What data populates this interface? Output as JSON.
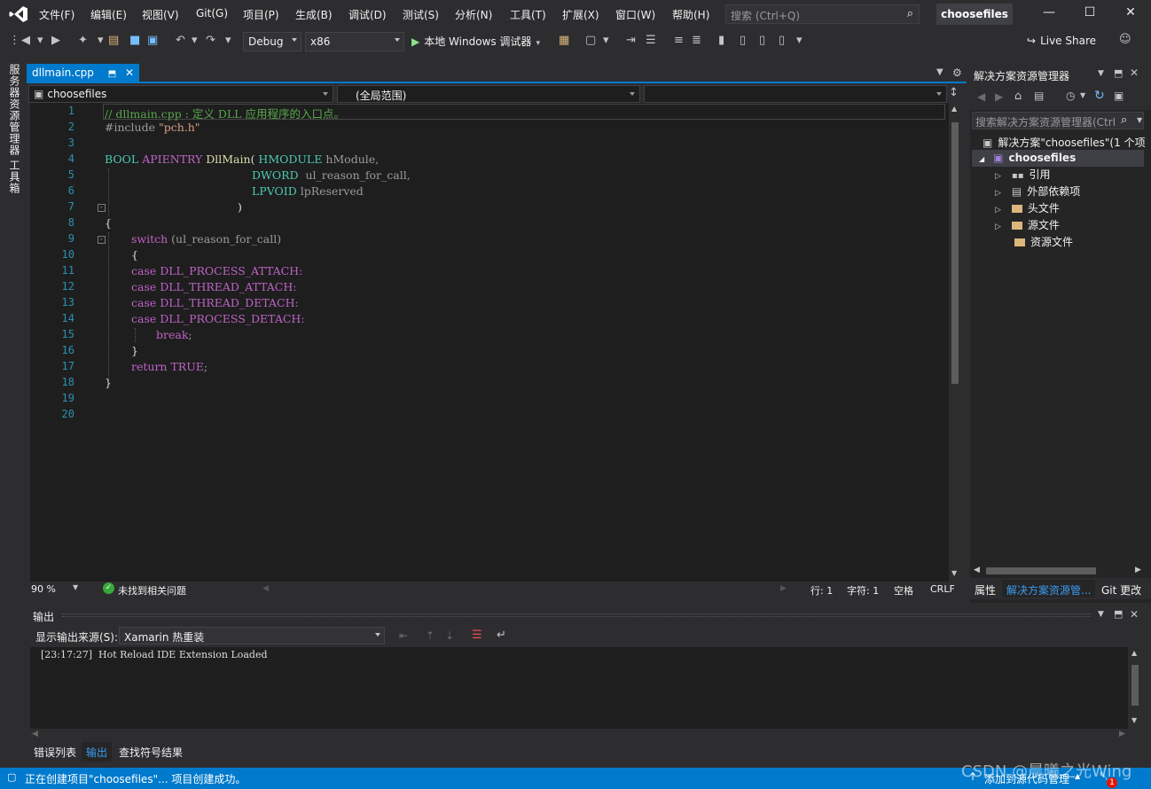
{
  "app": {
    "solution_title": "choosefiles",
    "menu": [
      "文件(F)",
      "编辑(E)",
      "视图(V)",
      "Git(G)",
      "项目(P)",
      "生成(B)",
      "调试(D)",
      "测试(S)",
      "分析(N)",
      "工具(T)",
      "扩展(X)",
      "窗口(W)",
      "帮助(H)"
    ],
    "search_placeholder": "搜索 (Ctrl+Q)"
  },
  "toolbar": {
    "config": "Debug",
    "platform": "x86",
    "run_label": "本地 Windows 调试器",
    "live_share": "Live Share"
  },
  "left_sidebar": {
    "server_explorer": "服务器资源管理器",
    "toolbox": "工具箱"
  },
  "editor": {
    "tab_name": "dllmain.cpp",
    "nav_project": "choosefiles",
    "nav_scope": "(全局范围)",
    "line_numbers": [
      "1",
      "2",
      "3",
      "4",
      "5",
      "6",
      "7",
      "8",
      "9",
      "10",
      "11",
      "12",
      "13",
      "14",
      "15",
      "16",
      "17",
      "18",
      "19",
      "20"
    ],
    "code": {
      "l1": "// dllmain.cpp : 定义 DLL 应用程序的入口点。",
      "l2a": "#include ",
      "l2b": "\"pch.h\"",
      "l4a": "BOOL",
      "l4b": " APIENTRY ",
      "l4c": "DllMain",
      "l4d": "( ",
      "l4e": "HMODULE",
      "l4f": " hModule,",
      "l5a": "DWORD",
      "l5b": "  ul_reason_for_call,",
      "l6a": "LPVOID",
      "l6b": " lpReserved",
      "l7": ")",
      "l8": "{",
      "l9a": "switch",
      "l9b": " (ul_reason_for_call)",
      "l10": "{",
      "case": "case",
      "l11": " DLL_PROCESS_ATTACH:",
      "l12": " DLL_THREAD_ATTACH:",
      "l13": " DLL_THREAD_DETACH:",
      "l14": " DLL_PROCESS_DETACH:",
      "l15a": "break",
      "l15b": ";",
      "l16": "}",
      "l17a": "return",
      "l17b": " TRUE",
      "l17c": ";",
      "l18": "}"
    },
    "zoom": "90 %",
    "issues": "未找到相关问题",
    "line": "行: 1",
    "char": "字符: 1",
    "whitespace": "空格",
    "eol": "CRLF"
  },
  "solution_explorer": {
    "title": "解决方案资源管理器",
    "search_placeholder": "搜索解决方案资源管理器(Ctrl",
    "solution_node": "解决方案\"choosefiles\"(1 个项",
    "project_node": "choosefiles",
    "items": [
      "引用",
      "外部依赖项",
      "头文件",
      "源文件",
      "资源文件"
    ],
    "tabs": [
      "属性",
      "解决方案资源管...",
      "Git 更改"
    ]
  },
  "output": {
    "title": "输出",
    "source_label": "显示输出来源(S):",
    "source_value": "Xamarin 热重装",
    "log": "[23:17:27]  Hot Reload IDE Extension Loaded"
  },
  "bottom_tabs": [
    "错误列表",
    "输出",
    "查找符号结果"
  ],
  "status": {
    "message": "正在创建项目\"choosefiles\"... 项目创建成功。",
    "source_control": "添加到源代码管理",
    "notifications": "1",
    "watermark": "CSDN @晨曦之光Wing"
  }
}
